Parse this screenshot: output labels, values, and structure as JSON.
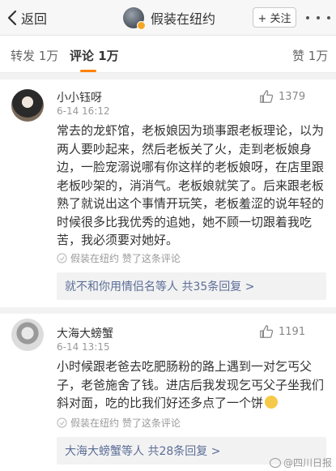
{
  "header": {
    "back_label": "返回",
    "title": "假装在纽约",
    "follow_label": "+ 关注"
  },
  "tabs": [
    {
      "label": "转发 1万",
      "active": false
    },
    {
      "label": "评论 1万",
      "active": true
    }
  ],
  "like_tab": "赞 1万",
  "comments": [
    {
      "user": "小小钰呀",
      "time": "6-14 16:12",
      "likes": "1379",
      "text_lines": [
        "常去的龙虾馆，老板娘因为琐事跟老板理论，以为",
        "两人要吵起来，然后老板关了火，走到老板娘身",
        "边，一脸宠溺说哪有你这样的老板娘呀，在店里跟",
        "老板吵架的，消消气。老板娘就笑了。后来跟老板",
        "熟了就说出这个事情开玩笑，老板羞涩的说年轻的",
        "时候很多比我优秀的追她，她不顾一切跟着我吃",
        "苦，我必须要对她好。"
      ],
      "author_liked": "假装在纽约 赞了这条评论",
      "replies_summary": "就不和你用情侣名等人  共35条回复 >"
    },
    {
      "user": "大海大螃蟹",
      "time": "6-14 13:15",
      "likes": "1191",
      "text_lines": [
        "小时候跟老爸去吃肥肠粉的路上遇到一对乞丐父",
        "子，老爸施舍了钱。进店后我发现乞丐父子坐我们",
        "斜对面，吃的比我们好还多点了一个饼"
      ],
      "author_liked": "假装在纽约 赞了这条评论",
      "replies_summary": "大海大螃蟹等人  共28条回复 >"
    }
  ],
  "watermark": "@四川日报",
  "colors": {
    "accent": "#ff8200",
    "link": "#5c6e97",
    "muted": "#999999"
  },
  "icons": {
    "back": "chevron-left-icon",
    "like": "thumbs-up-icon",
    "author_like": "author-like-icon"
  }
}
